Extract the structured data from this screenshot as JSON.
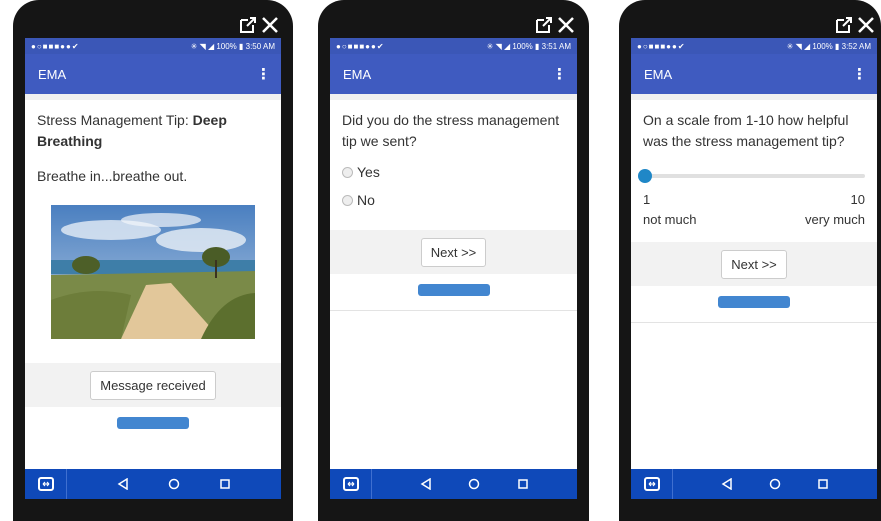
{
  "phones": [
    {
      "status_time": "100% ▮ 3:50 AM",
      "app_title": "EMA",
      "tip_prefix": "Stress Management Tip: ",
      "tip_name": "Deep Breathing",
      "tip_body": "Breathe in...breathe out.",
      "button": "Message received"
    },
    {
      "status_time": "100% ▮ 3:51 AM",
      "app_title": "EMA",
      "question": "Did you do the stress management tip we sent?",
      "options": [
        "Yes",
        "No"
      ],
      "button": "Next >>"
    },
    {
      "status_time": "100% ▮ 3:52 AM",
      "app_title": "EMA",
      "question": "On a scale from 1-10 how helpful was the stress management tip?",
      "scale_min": "1",
      "scale_max": "10",
      "scale_min_label": "not much",
      "scale_max_label": "very much",
      "slider_value": 1,
      "button": "Next >>"
    }
  ],
  "status_icons": "●○■■■●●✔",
  "status_signal": "✳ ◥ ◢"
}
